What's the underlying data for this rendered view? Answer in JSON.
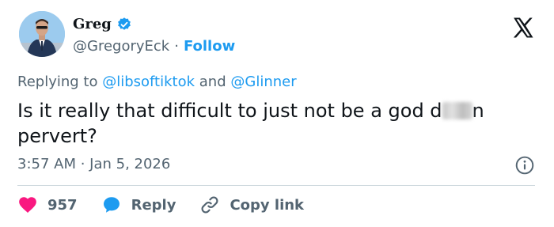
{
  "author": {
    "name": "Greg",
    "handle": "@GregoryEck",
    "separator": "·",
    "follow_label": "Follow",
    "verified": true
  },
  "brand": {
    "logo_icon": "x-logo-icon",
    "color": "#0f1419"
  },
  "reply_context": {
    "prefix": "Replying to",
    "mention_1": "@libsoftiktok",
    "conjunction": "and",
    "mention_2": "@Glinner"
  },
  "tweet": {
    "text_part_1": "Is it really that difficult to just not be a god d",
    "text_part_2": "n",
    "text_part_3": "pervert?",
    "time": "3:57 AM · Jan 5, 2026"
  },
  "actions": {
    "like_count": "957",
    "reply_label": "Reply",
    "copy_label": "Copy link"
  },
  "colors": {
    "accent": "#1d9bf0",
    "like": "#f91880",
    "muted": "#536471",
    "text": "#0f1419",
    "divider": "#cfd9de"
  }
}
